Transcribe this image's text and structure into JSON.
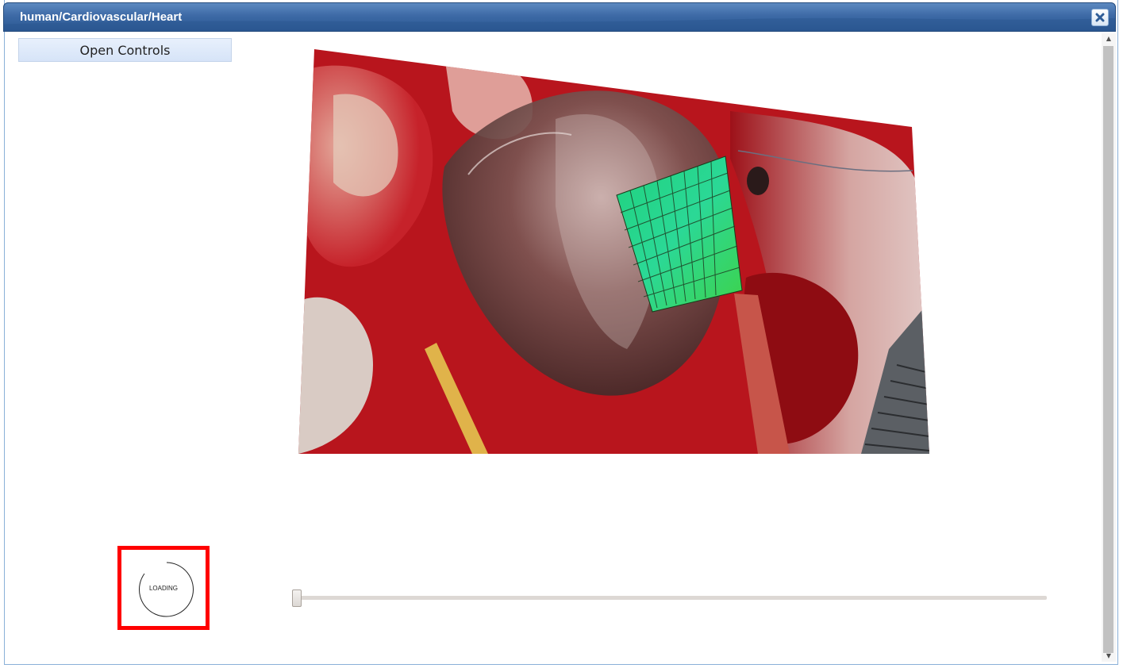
{
  "window": {
    "title": "human/Cardiovascular/Heart",
    "close_icon": "close-icon"
  },
  "controls": {
    "open_label": "Open Controls"
  },
  "loader": {
    "text": "LOADING"
  },
  "timeline": {
    "position": 0
  },
  "colors": {
    "titlebar": "#3d6aa6",
    "highlight_border": "#ff0000",
    "mesh_overlay": "#2ee07a"
  }
}
